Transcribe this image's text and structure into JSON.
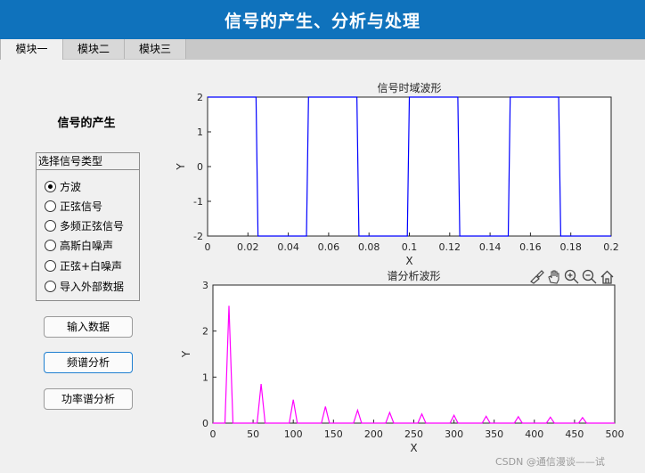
{
  "app": {
    "title": "信号的产生、分析与处理"
  },
  "tabs": [
    {
      "label": "模块一",
      "active": true
    },
    {
      "label": "模块二",
      "active": false
    },
    {
      "label": "模块三",
      "active": false
    }
  ],
  "generator": {
    "title": "信号的产生",
    "group_title": "选择信号类型",
    "options": [
      {
        "label": "方波",
        "selected": true
      },
      {
        "label": "正弦信号",
        "selected": false
      },
      {
        "label": "多频正弦信号",
        "selected": false
      },
      {
        "label": "高斯白噪声",
        "selected": false
      },
      {
        "label": "正弦+白噪声",
        "selected": false
      },
      {
        "label": "导入外部数据",
        "selected": false
      }
    ]
  },
  "buttons": {
    "input_data": "输入数据",
    "spectrum": "频谱分析",
    "power_spectrum": "功率谱分析"
  },
  "axes_toolbar": [
    "brush-icon",
    "pan-hand-icon",
    "zoom-in-icon",
    "zoom-out-icon",
    "home-icon"
  ],
  "watermark": "CSDN @通信漫谈——试",
  "chart_data": [
    {
      "type": "line",
      "title": "信号时域波形",
      "xlabel": "X",
      "ylabel": "Y",
      "xlim": [
        0,
        0.2
      ],
      "ylim": [
        -2,
        2
      ],
      "xticks": [
        "0",
        "0.02",
        "0.04",
        "0.06",
        "0.08",
        "0.1",
        "0.12",
        "0.14",
        "0.16",
        "0.18",
        "0.2"
      ],
      "yticks": [
        "-2",
        "-1",
        "0",
        "1",
        "2"
      ],
      "color": "#0000ff",
      "series": [
        {
          "x": [
            0,
            0.024,
            0.025,
            0.049,
            0.05,
            0.074,
            0.075,
            0.099,
            0.1,
            0.124,
            0.125,
            0.149,
            0.15,
            0.174,
            0.175,
            0.2
          ],
          "y": [
            2,
            2,
            -2,
            -2,
            2,
            2,
            -2,
            -2,
            2,
            2,
            -2,
            -2,
            2,
            2,
            -2,
            -2
          ]
        }
      ]
    },
    {
      "type": "line",
      "title": "谱分析波形",
      "xlabel": "X",
      "ylabel": "Y",
      "xlim": [
        0,
        500
      ],
      "ylim": [
        0,
        3
      ],
      "xticks": [
        "0",
        "50",
        "100",
        "150",
        "200",
        "250",
        "300",
        "350",
        "400",
        "450",
        "500"
      ],
      "yticks": [
        "0",
        "1",
        "2",
        "3"
      ],
      "color": "#ff00ff",
      "series": [
        {
          "x": [
            0,
            15,
            20,
            25,
            55,
            60,
            65,
            95,
            100,
            105,
            135,
            140,
            145,
            175,
            180,
            185,
            215,
            220,
            225,
            255,
            260,
            265,
            295,
            300,
            305,
            335,
            340,
            345,
            375,
            380,
            385,
            415,
            420,
            425,
            455,
            460,
            465,
            500
          ],
          "y": [
            0,
            0,
            2.55,
            0,
            0,
            0.85,
            0,
            0,
            0.51,
            0,
            0,
            0.36,
            0,
            0,
            0.28,
            0,
            0,
            0.23,
            0,
            0,
            0.2,
            0,
            0,
            0.17,
            0,
            0,
            0.15,
            0,
            0,
            0.14,
            0,
            0,
            0.13,
            0,
            0,
            0.12,
            0,
            0
          ]
        }
      ]
    }
  ]
}
